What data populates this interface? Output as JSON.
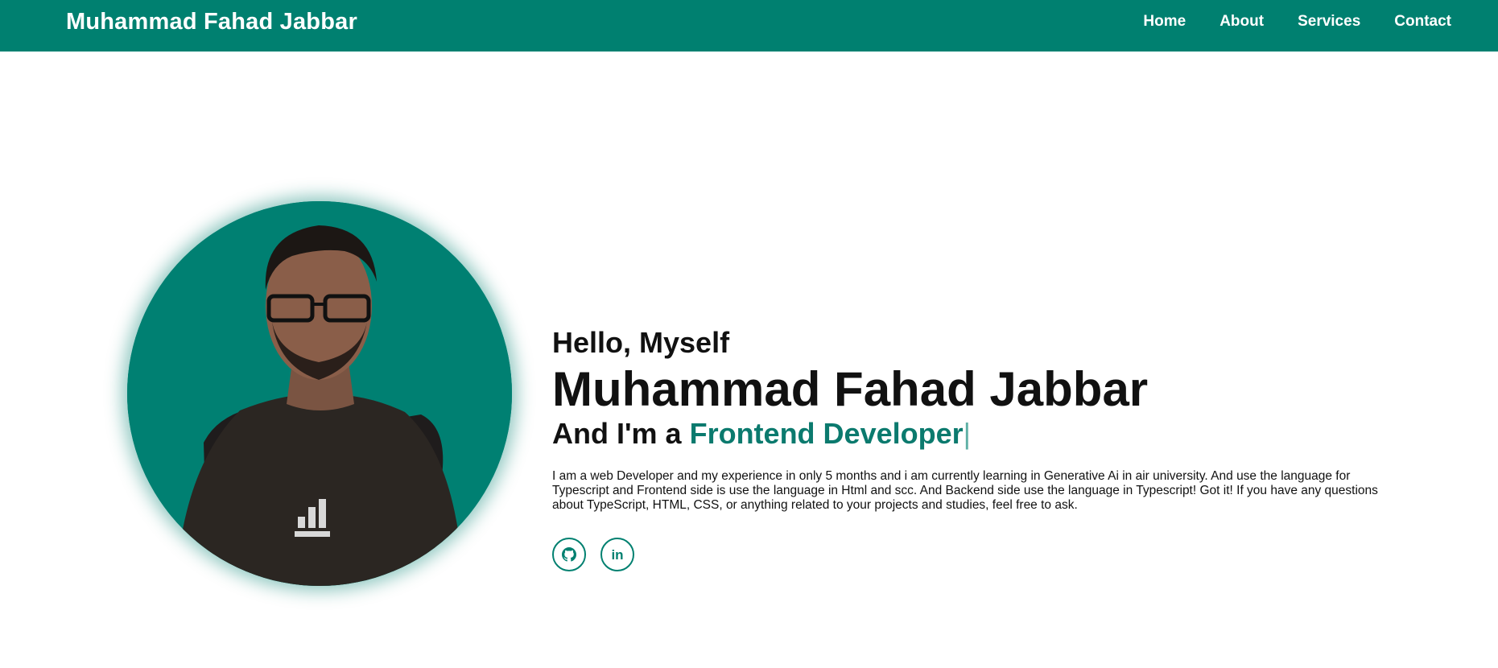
{
  "header": {
    "brand": "Muhammad Fahad Jabbar",
    "nav": [
      {
        "label": "Home"
      },
      {
        "label": "About"
      },
      {
        "label": "Services"
      },
      {
        "label": "Contact"
      }
    ]
  },
  "hero": {
    "greeting": "Hello, Myself",
    "name": "Muhammad Fahad Jabbar",
    "role_prefix": "And I'm a ",
    "role_highlight": "Frontend Developer",
    "cursor": "|",
    "bio": "I am a web Developer and my experience in only 5 months and i am currently learning in Generative Ai in air university. And use the language for Typescript and Frontend side is use the language in Html and scc. And Backend side use the language in Typescript! Got it! If you have any questions about TypeScript, HTML, CSS, or anything related to your projects and studies, feel free to ask.",
    "avatar_icon": "profile-photo",
    "socials": [
      {
        "name": "github-icon"
      },
      {
        "name": "linkedin-icon",
        "glyph": "in"
      }
    ]
  },
  "colors": {
    "brand": "#008070",
    "highlight": "#0b7a6e",
    "background": "#ffffff"
  }
}
